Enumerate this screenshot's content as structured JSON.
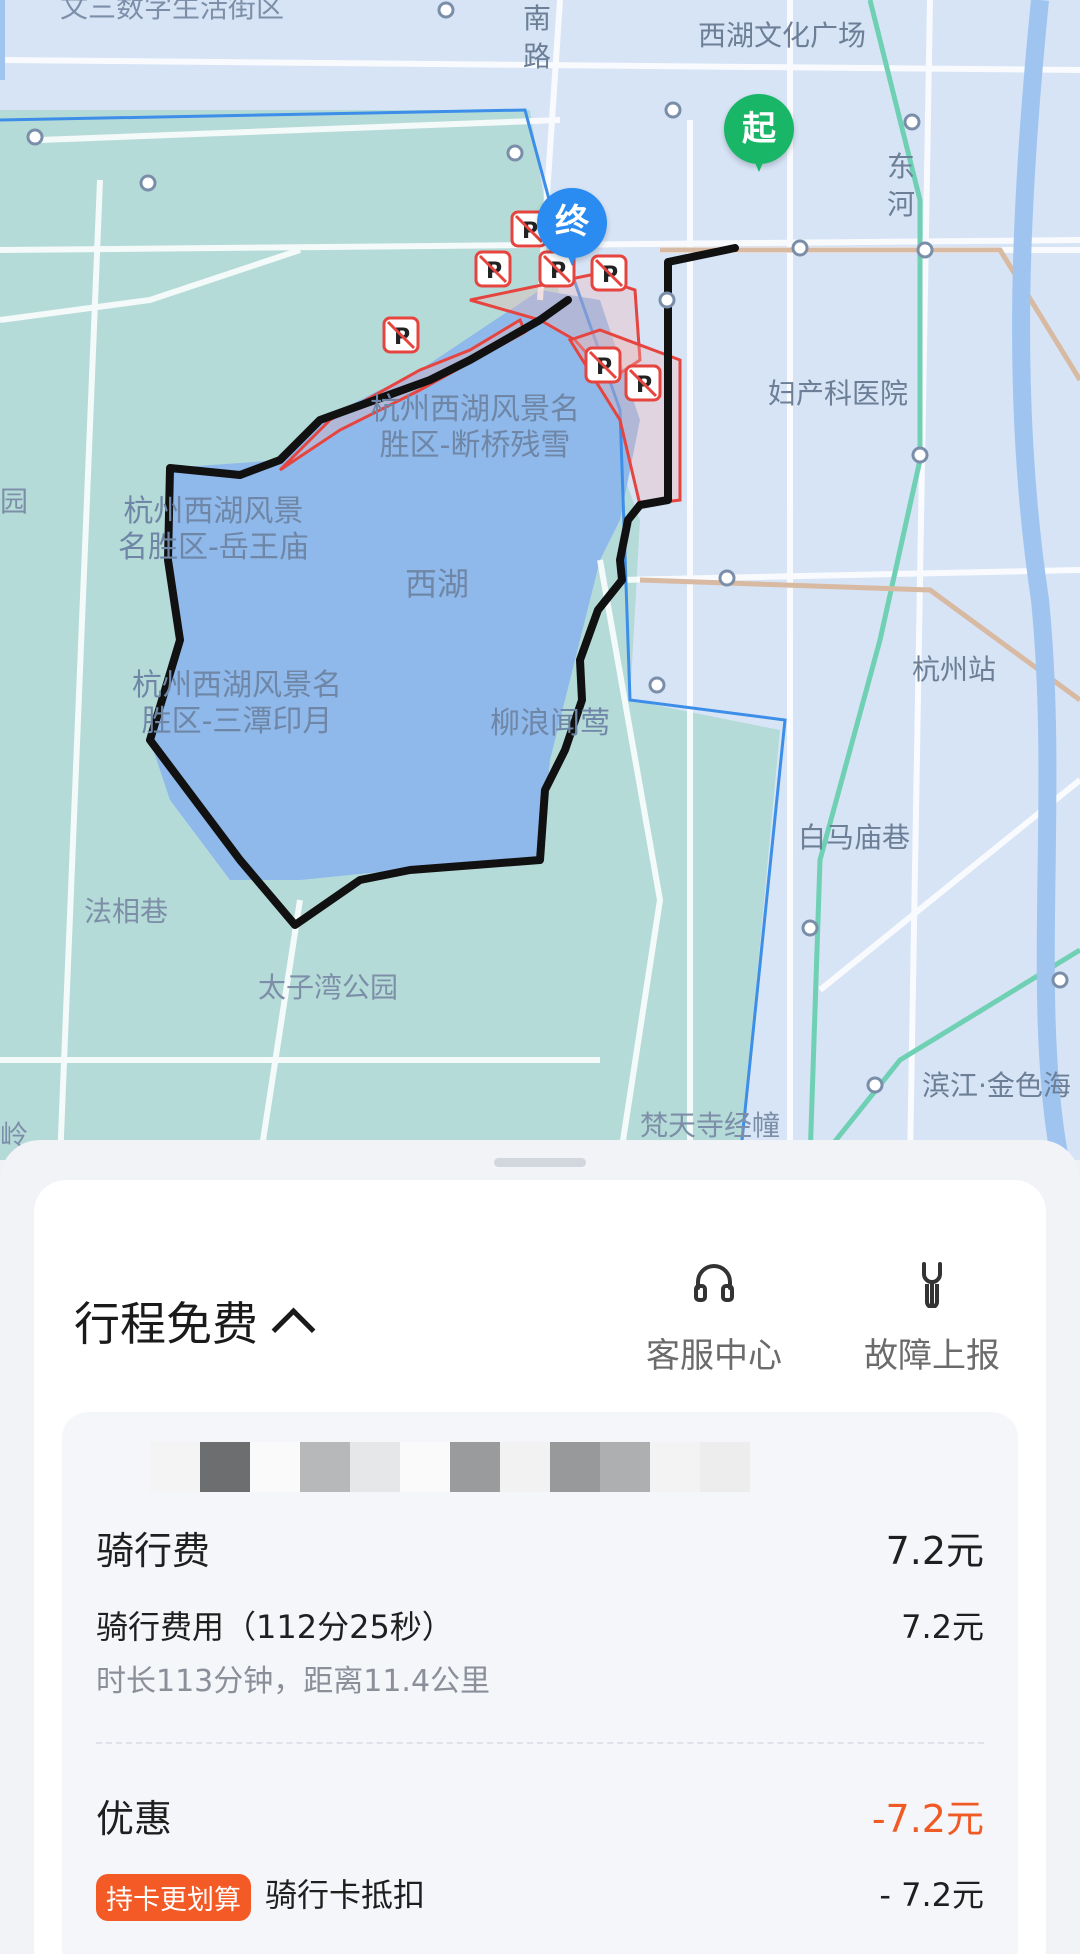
{
  "map": {
    "labels": {
      "district_top": "文三数字生活街区",
      "road_nan": "南\n路",
      "xihu_culture": "西湖文化广场",
      "donghe": "东\n河",
      "fuchan": "妇产科医院",
      "duanqiao": "杭州西湖风景名\n胜区-断桥残雪",
      "yuewang": "杭州西湖风景\n名胜区-岳王庙",
      "yuan": "园",
      "xihu": "西湖",
      "santan": "杭州西湖风景名\n胜区-三潭印月",
      "liulang": "柳浪闻莺",
      "hangzhou_station": "杭州站",
      "baimamiao": "白马庙巷",
      "faxiang": "法相巷",
      "taiziwan": "太子湾公园",
      "binjiang": "滨江·金色海",
      "fantian": "梵天寺经幢",
      "ling": "岭"
    },
    "start_pin": "起",
    "end_pin": "终",
    "route_color": "#1a1a1a",
    "no_parking_icon": "no-parking-icon"
  },
  "sheet": {
    "title": "行程免费",
    "actions": {
      "service_label": "客服中心",
      "repair_label": "故障上报"
    },
    "fee": {
      "label": "骑行费",
      "amount": "7.2元",
      "item_label": "骑行费用（112分25秒）",
      "item_amount": "7.2元",
      "meta": "时长113分钟，距离11.4公里"
    },
    "discount": {
      "label": "优惠",
      "amount": "-7.2元",
      "tag": "持卡更划算",
      "item_label": "骑行卡抵扣",
      "item_amount": "- 7.2元"
    }
  },
  "colors": {
    "accent_orange": "#f05a24",
    "start_green": "#19b668",
    "end_blue": "#2a8cf0"
  }
}
